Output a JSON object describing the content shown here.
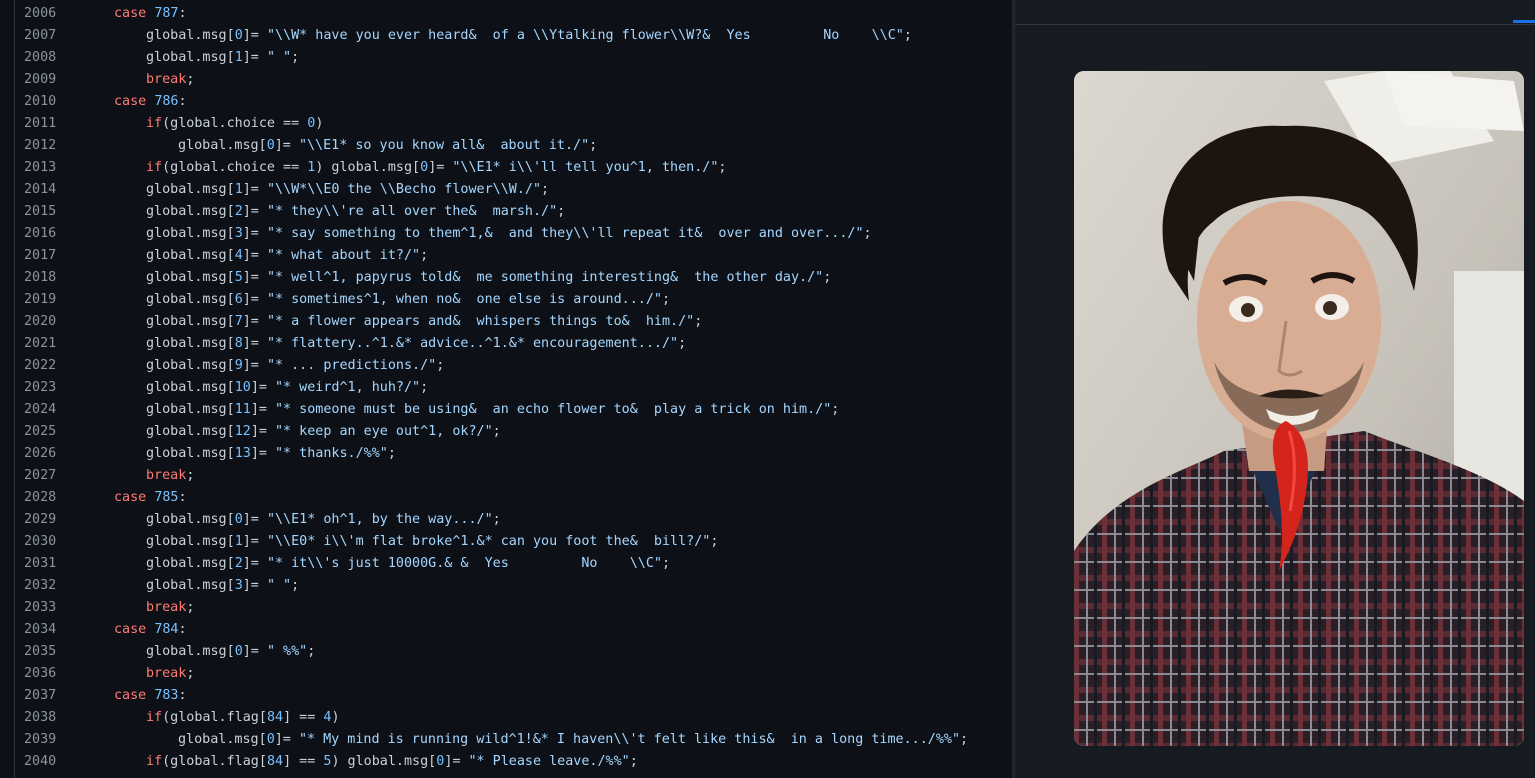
{
  "editor": {
    "lines": [
      {
        "no": "2006",
        "indent": 1,
        "tokens": [
          {
            "t": "kw",
            "v": "case "
          },
          {
            "t": "num",
            "v": "787"
          },
          {
            "t": "plain",
            "v": ":"
          }
        ]
      },
      {
        "no": "2007",
        "indent": 2,
        "tokens": [
          {
            "t": "plain",
            "v": "global.msg["
          },
          {
            "t": "num",
            "v": "0"
          },
          {
            "t": "plain",
            "v": "]= "
          },
          {
            "t": "str",
            "v": "\"\\\\W* have you ever heard&  of a \\\\Ytalking flower\\\\W?&  Yes         No    \\\\C\""
          },
          {
            "t": "plain",
            "v": ";"
          }
        ]
      },
      {
        "no": "2008",
        "indent": 2,
        "tokens": [
          {
            "t": "plain",
            "v": "global.msg["
          },
          {
            "t": "num",
            "v": "1"
          },
          {
            "t": "plain",
            "v": "]= "
          },
          {
            "t": "str",
            "v": "\" \""
          },
          {
            "t": "plain",
            "v": ";"
          }
        ]
      },
      {
        "no": "2009",
        "indent": 2,
        "tokens": [
          {
            "t": "kw",
            "v": "break"
          },
          {
            "t": "plain",
            "v": ";"
          }
        ]
      },
      {
        "no": "2010",
        "indent": 1,
        "tokens": [
          {
            "t": "kw",
            "v": "case "
          },
          {
            "t": "num",
            "v": "786"
          },
          {
            "t": "plain",
            "v": ":"
          }
        ]
      },
      {
        "no": "2011",
        "indent": 2,
        "tokens": [
          {
            "t": "kw",
            "v": "if"
          },
          {
            "t": "plain",
            "v": "(global.choice == "
          },
          {
            "t": "num",
            "v": "0"
          },
          {
            "t": "plain",
            "v": ")"
          }
        ]
      },
      {
        "no": "2012",
        "indent": 3,
        "tokens": [
          {
            "t": "plain",
            "v": "global.msg["
          },
          {
            "t": "num",
            "v": "0"
          },
          {
            "t": "plain",
            "v": "]= "
          },
          {
            "t": "str",
            "v": "\"\\\\E1* so you know all&  about it./\""
          },
          {
            "t": "plain",
            "v": ";"
          }
        ]
      },
      {
        "no": "2013",
        "indent": 2,
        "tokens": [
          {
            "t": "kw",
            "v": "if"
          },
          {
            "t": "plain",
            "v": "(global.choice == "
          },
          {
            "t": "num",
            "v": "1"
          },
          {
            "t": "plain",
            "v": ") global.msg["
          },
          {
            "t": "num",
            "v": "0"
          },
          {
            "t": "plain",
            "v": "]= "
          },
          {
            "t": "str",
            "v": "\"\\\\E1* i\\\\'ll tell you^1, then./\""
          },
          {
            "t": "plain",
            "v": ";"
          }
        ]
      },
      {
        "no": "2014",
        "indent": 2,
        "tokens": [
          {
            "t": "plain",
            "v": "global.msg["
          },
          {
            "t": "num",
            "v": "1"
          },
          {
            "t": "plain",
            "v": "]= "
          },
          {
            "t": "str",
            "v": "\"\\\\W*\\\\E0 the \\\\Becho flower\\\\W./\""
          },
          {
            "t": "plain",
            "v": ";"
          }
        ]
      },
      {
        "no": "2015",
        "indent": 2,
        "tokens": [
          {
            "t": "plain",
            "v": "global.msg["
          },
          {
            "t": "num",
            "v": "2"
          },
          {
            "t": "plain",
            "v": "]= "
          },
          {
            "t": "str",
            "v": "\"* they\\\\'re all over the&  marsh./\""
          },
          {
            "t": "plain",
            "v": ";"
          }
        ]
      },
      {
        "no": "2016",
        "indent": 2,
        "tokens": [
          {
            "t": "plain",
            "v": "global.msg["
          },
          {
            "t": "num",
            "v": "3"
          },
          {
            "t": "plain",
            "v": "]= "
          },
          {
            "t": "str",
            "v": "\"* say something to them^1,&  and they\\\\'ll repeat it&  over and over.../\""
          },
          {
            "t": "plain",
            "v": ";"
          }
        ]
      },
      {
        "no": "2017",
        "indent": 2,
        "tokens": [
          {
            "t": "plain",
            "v": "global.msg["
          },
          {
            "t": "num",
            "v": "4"
          },
          {
            "t": "plain",
            "v": "]= "
          },
          {
            "t": "str",
            "v": "\"* what about it?/\""
          },
          {
            "t": "plain",
            "v": ";"
          }
        ]
      },
      {
        "no": "2018",
        "indent": 2,
        "tokens": [
          {
            "t": "plain",
            "v": "global.msg["
          },
          {
            "t": "num",
            "v": "5"
          },
          {
            "t": "plain",
            "v": "]= "
          },
          {
            "t": "str",
            "v": "\"* well^1, papyrus told&  me something interesting&  the other day./\""
          },
          {
            "t": "plain",
            "v": ";"
          }
        ]
      },
      {
        "no": "2019",
        "indent": 2,
        "tokens": [
          {
            "t": "plain",
            "v": "global.msg["
          },
          {
            "t": "num",
            "v": "6"
          },
          {
            "t": "plain",
            "v": "]= "
          },
          {
            "t": "str",
            "v": "\"* sometimes^1, when no&  one else is around.../\""
          },
          {
            "t": "plain",
            "v": ";"
          }
        ]
      },
      {
        "no": "2020",
        "indent": 2,
        "tokens": [
          {
            "t": "plain",
            "v": "global.msg["
          },
          {
            "t": "num",
            "v": "7"
          },
          {
            "t": "plain",
            "v": "]= "
          },
          {
            "t": "str",
            "v": "\"* a flower appears and&  whispers things to&  him./\""
          },
          {
            "t": "plain",
            "v": ";"
          }
        ]
      },
      {
        "no": "2021",
        "indent": 2,
        "tokens": [
          {
            "t": "plain",
            "v": "global.msg["
          },
          {
            "t": "num",
            "v": "8"
          },
          {
            "t": "plain",
            "v": "]= "
          },
          {
            "t": "str",
            "v": "\"* flattery..^1.&* advice..^1.&* encouragement.../\""
          },
          {
            "t": "plain",
            "v": ";"
          }
        ]
      },
      {
        "no": "2022",
        "indent": 2,
        "tokens": [
          {
            "t": "plain",
            "v": "global.msg["
          },
          {
            "t": "num",
            "v": "9"
          },
          {
            "t": "plain",
            "v": "]= "
          },
          {
            "t": "str",
            "v": "\"* ... predictions./\""
          },
          {
            "t": "plain",
            "v": ";"
          }
        ]
      },
      {
        "no": "2023",
        "indent": 2,
        "tokens": [
          {
            "t": "plain",
            "v": "global.msg["
          },
          {
            "t": "num",
            "v": "10"
          },
          {
            "t": "plain",
            "v": "]= "
          },
          {
            "t": "str",
            "v": "\"* weird^1, huh?/\""
          },
          {
            "t": "plain",
            "v": ";"
          }
        ]
      },
      {
        "no": "2024",
        "indent": 2,
        "tokens": [
          {
            "t": "plain",
            "v": "global.msg["
          },
          {
            "t": "num",
            "v": "11"
          },
          {
            "t": "plain",
            "v": "]= "
          },
          {
            "t": "str",
            "v": "\"* someone must be using&  an echo flower to&  play a trick on him./\""
          },
          {
            "t": "plain",
            "v": ";"
          }
        ]
      },
      {
        "no": "2025",
        "indent": 2,
        "tokens": [
          {
            "t": "plain",
            "v": "global.msg["
          },
          {
            "t": "num",
            "v": "12"
          },
          {
            "t": "plain",
            "v": "]= "
          },
          {
            "t": "str",
            "v": "\"* keep an eye out^1, ok?/\""
          },
          {
            "t": "plain",
            "v": ";"
          }
        ]
      },
      {
        "no": "2026",
        "indent": 2,
        "tokens": [
          {
            "t": "plain",
            "v": "global.msg["
          },
          {
            "t": "num",
            "v": "13"
          },
          {
            "t": "plain",
            "v": "]= "
          },
          {
            "t": "str",
            "v": "\"* thanks./%%\""
          },
          {
            "t": "plain",
            "v": ";"
          }
        ]
      },
      {
        "no": "2027",
        "indent": 2,
        "tokens": [
          {
            "t": "kw",
            "v": "break"
          },
          {
            "t": "plain",
            "v": ";"
          }
        ]
      },
      {
        "no": "2028",
        "indent": 1,
        "tokens": [
          {
            "t": "kw",
            "v": "case "
          },
          {
            "t": "num",
            "v": "785"
          },
          {
            "t": "plain",
            "v": ":"
          }
        ]
      },
      {
        "no": "2029",
        "indent": 2,
        "tokens": [
          {
            "t": "plain",
            "v": "global.msg["
          },
          {
            "t": "num",
            "v": "0"
          },
          {
            "t": "plain",
            "v": "]= "
          },
          {
            "t": "str",
            "v": "\"\\\\E1* oh^1, by the way.../\""
          },
          {
            "t": "plain",
            "v": ";"
          }
        ]
      },
      {
        "no": "2030",
        "indent": 2,
        "tokens": [
          {
            "t": "plain",
            "v": "global.msg["
          },
          {
            "t": "num",
            "v": "1"
          },
          {
            "t": "plain",
            "v": "]= "
          },
          {
            "t": "str",
            "v": "\"\\\\E0* i\\\\'m flat broke^1.&* can you foot the&  bill?/\""
          },
          {
            "t": "plain",
            "v": ";"
          }
        ]
      },
      {
        "no": "2031",
        "indent": 2,
        "tokens": [
          {
            "t": "plain",
            "v": "global.msg["
          },
          {
            "t": "num",
            "v": "2"
          },
          {
            "t": "plain",
            "v": "]= "
          },
          {
            "t": "str",
            "v": "\"* it\\\\'s just 10000G.& &  Yes         No    \\\\C\""
          },
          {
            "t": "plain",
            "v": ";"
          }
        ]
      },
      {
        "no": "2032",
        "indent": 2,
        "tokens": [
          {
            "t": "plain",
            "v": "global.msg["
          },
          {
            "t": "num",
            "v": "3"
          },
          {
            "t": "plain",
            "v": "]= "
          },
          {
            "t": "str",
            "v": "\" \""
          },
          {
            "t": "plain",
            "v": ";"
          }
        ]
      },
      {
        "no": "2033",
        "indent": 2,
        "tokens": [
          {
            "t": "kw",
            "v": "break"
          },
          {
            "t": "plain",
            "v": ";"
          }
        ]
      },
      {
        "no": "2034",
        "indent": 1,
        "tokens": [
          {
            "t": "kw",
            "v": "case "
          },
          {
            "t": "num",
            "v": "784"
          },
          {
            "t": "plain",
            "v": ":"
          }
        ]
      },
      {
        "no": "2035",
        "indent": 2,
        "tokens": [
          {
            "t": "plain",
            "v": "global.msg["
          },
          {
            "t": "num",
            "v": "0"
          },
          {
            "t": "plain",
            "v": "]= "
          },
          {
            "t": "str",
            "v": "\" %%\""
          },
          {
            "t": "plain",
            "v": ";"
          }
        ]
      },
      {
        "no": "2036",
        "indent": 2,
        "tokens": [
          {
            "t": "kw",
            "v": "break"
          },
          {
            "t": "plain",
            "v": ";"
          }
        ]
      },
      {
        "no": "2037",
        "indent": 1,
        "tokens": [
          {
            "t": "kw",
            "v": "case "
          },
          {
            "t": "num",
            "v": "783"
          },
          {
            "t": "plain",
            "v": ":"
          }
        ]
      },
      {
        "no": "2038",
        "indent": 2,
        "tokens": [
          {
            "t": "kw",
            "v": "if"
          },
          {
            "t": "plain",
            "v": "(global.flag["
          },
          {
            "t": "num",
            "v": "84"
          },
          {
            "t": "plain",
            "v": "] == "
          },
          {
            "t": "num",
            "v": "4"
          },
          {
            "t": "plain",
            "v": ")"
          }
        ]
      },
      {
        "no": "2039",
        "indent": 3,
        "tokens": [
          {
            "t": "plain",
            "v": "global.msg["
          },
          {
            "t": "num",
            "v": "0"
          },
          {
            "t": "plain",
            "v": "]= "
          },
          {
            "t": "str",
            "v": "\"* My mind is running wild^1!&* I haven\\\\'t felt like this&  in a long time.../%%\""
          },
          {
            "t": "plain",
            "v": ";"
          }
        ]
      },
      {
        "no": "2040",
        "indent": 2,
        "tokens": [
          {
            "t": "kw",
            "v": "if"
          },
          {
            "t": "plain",
            "v": "(global.flag["
          },
          {
            "t": "num",
            "v": "84"
          },
          {
            "t": "plain",
            "v": "] == "
          },
          {
            "t": "num",
            "v": "5"
          },
          {
            "t": "plain",
            "v": ") global.msg["
          },
          {
            "t": "num",
            "v": "0"
          },
          {
            "t": "plain",
            "v": "]= "
          },
          {
            "t": "str",
            "v": "\"* Please leave./%%\""
          },
          {
            "t": "plain",
            "v": ";"
          }
        ]
      }
    ]
  },
  "colors": {
    "background": "#0d1117",
    "keyword": "#ff7b72",
    "number": "#79c0ff",
    "string": "#a5d6ff",
    "plain": "#c9d1d9",
    "line_number": "#8b949e",
    "side_panel": "#161b22",
    "accent": "#1f6feb"
  },
  "side_panel": {
    "photo_description": "photo of a person with a red chili pepper in mouth"
  }
}
